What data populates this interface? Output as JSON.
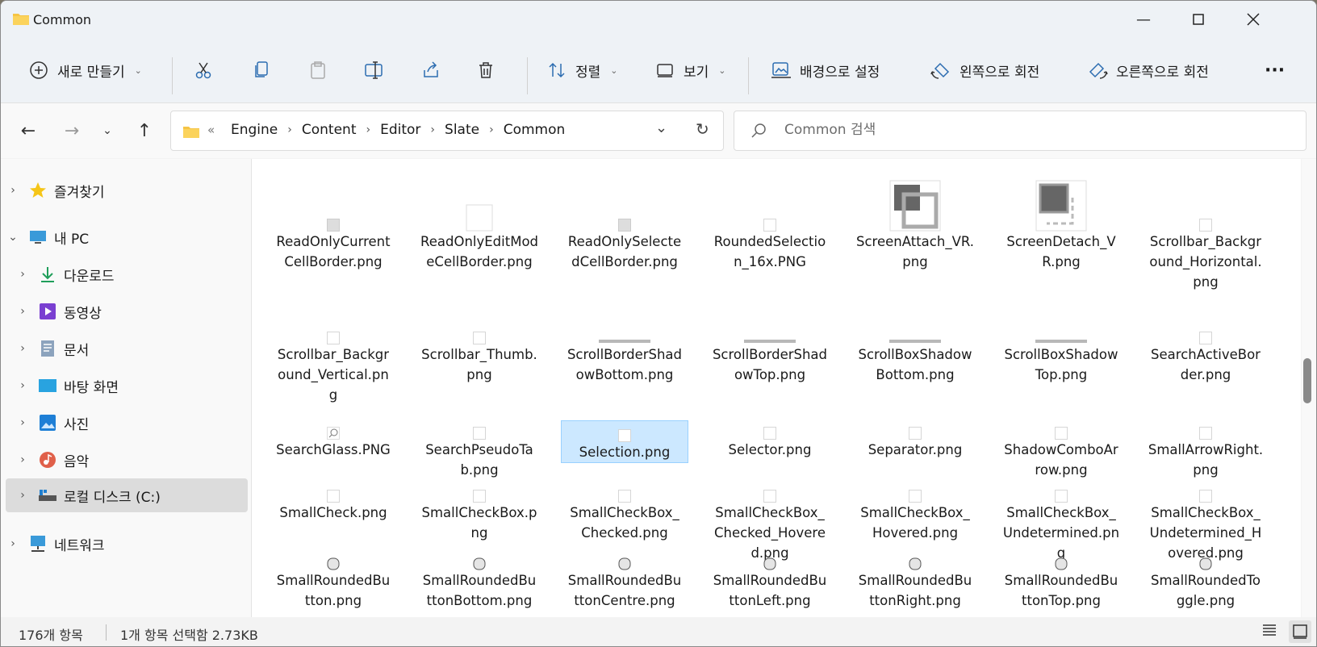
{
  "window": {
    "title": "Common"
  },
  "toolbar": {
    "new_label": "새로 만들기",
    "sort_label": "정렬",
    "view_label": "보기",
    "set_background_label": "배경으로 설정",
    "rotate_left_label": "왼쪽으로 회전",
    "rotate_right_label": "오른쪽으로 회전",
    "more_label": "···"
  },
  "address": {
    "overflow": "«",
    "crumbs": [
      "Engine",
      "Content",
      "Editor",
      "Slate",
      "Common"
    ]
  },
  "search": {
    "placeholder": "Common 검색"
  },
  "sidebar": {
    "items": [
      {
        "label": "즐겨찾기",
        "icon": "star-icon"
      },
      {
        "label": "내 PC",
        "icon": "pc-icon"
      },
      {
        "label": "다운로드",
        "icon": "download-icon"
      },
      {
        "label": "동영상",
        "icon": "video-icon"
      },
      {
        "label": "문서",
        "icon": "document-icon"
      },
      {
        "label": "바탕 화면",
        "icon": "desktop-icon"
      },
      {
        "label": "사진",
        "icon": "picture-icon"
      },
      {
        "label": "음악",
        "icon": "music-icon"
      },
      {
        "label": "로컬 디스크 (C:)",
        "icon": "drive-icon"
      },
      {
        "label": "네트워크",
        "icon": "network-icon"
      }
    ]
  },
  "files": [
    [
      "ReadOnlyCurrentCellBorder.png",
      "ReadOnlyEditModeCellBorder.png",
      "ReadOnlySelectedCellBorder.png",
      "RoundedSelection_16x.PNG",
      "ScreenAttach_VR.png",
      "ScreenDetach_VR.png",
      "Scrollbar_Background_Horizontal.png"
    ],
    [
      "Scrollbar_Background_Vertical.png",
      "Scrollbar_Thumb.png",
      "ScrollBorderShadowBottom.png",
      "ScrollBorderShadowTop.png",
      "ScrollBoxShadowBottom.png",
      "ScrollBoxShadowTop.png",
      "SearchActiveBorder.png"
    ],
    [
      "SearchGlass.PNG",
      "SearchPseudoTab.png",
      "Selection.png",
      "Selector.png",
      "Separator.png",
      "ShadowComboArrow.png",
      "SmallArrowRight.png"
    ],
    [
      "SmallCheck.png",
      "SmallCheckBox.png",
      "SmallCheckBox_Checked.png",
      "SmallCheckBox_Checked_Hovered.png",
      "SmallCheckBox_Hovered.png",
      "SmallCheckBox_Undetermined.png",
      "SmallCheckBox_Undetermined_Hovered.png"
    ],
    [
      "SmallRoundedButton.png",
      "SmallRoundedButtonBottom.png",
      "SmallRoundedButtonCentre.png",
      "SmallRoundedButtonLeft.png",
      "SmallRoundedButtonRight.png",
      "SmallRoundedButtonTop.png",
      "SmallRoundedToggle.png"
    ]
  ],
  "selected_file": "Selection.png",
  "status": {
    "count": "176개 항목",
    "selection": "1개 항목 선택함 2.73KB"
  }
}
